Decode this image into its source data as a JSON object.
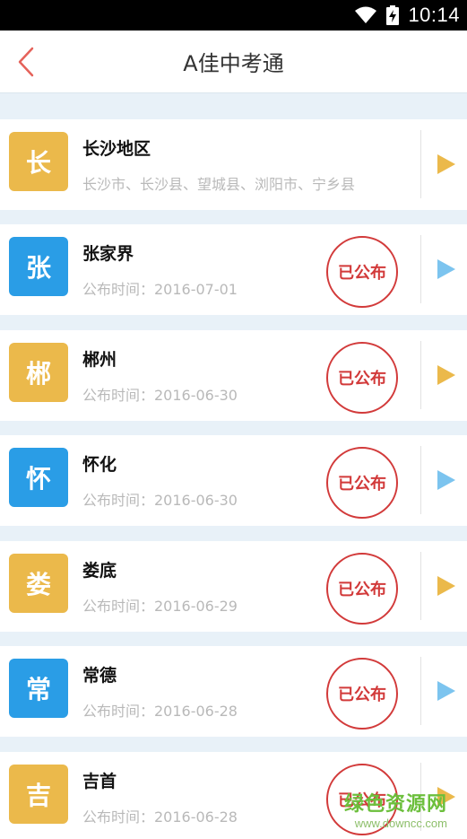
{
  "status_bar": {
    "time": "10:14"
  },
  "header": {
    "title": "A佳中考通"
  },
  "colors": {
    "yellow": "#ebb94b",
    "blue": "#2a9de6",
    "stamp_red": "#d23a3a",
    "arrow_yellow": "#ebb94b",
    "arrow_blue": "#7cc4ef"
  },
  "rows": [
    {
      "badge": "长",
      "name": "长沙地区",
      "sub": "长沙市、长沙县、望城县、浏阳市、宁乡县",
      "stamp": ""
    },
    {
      "badge": "张",
      "name": "张家界",
      "sub": "公布时间：2016-07-01",
      "stamp": "已公布"
    },
    {
      "badge": "郴",
      "name": "郴州",
      "sub": "公布时间：2016-06-30",
      "stamp": "已公布"
    },
    {
      "badge": "怀",
      "name": "怀化",
      "sub": "公布时间：2016-06-30",
      "stamp": "已公布"
    },
    {
      "badge": "娄",
      "name": "娄底",
      "sub": "公布时间：2016-06-29",
      "stamp": "已公布"
    },
    {
      "badge": "常",
      "name": "常德",
      "sub": "公布时间：2016-06-28",
      "stamp": "已公布"
    },
    {
      "badge": "吉",
      "name": "吉首",
      "sub": "公布时间：2016-06-28",
      "stamp": "已公布"
    }
  ],
  "watermark": {
    "main": "绿色资源网",
    "sub": "www.downcc.com"
  }
}
